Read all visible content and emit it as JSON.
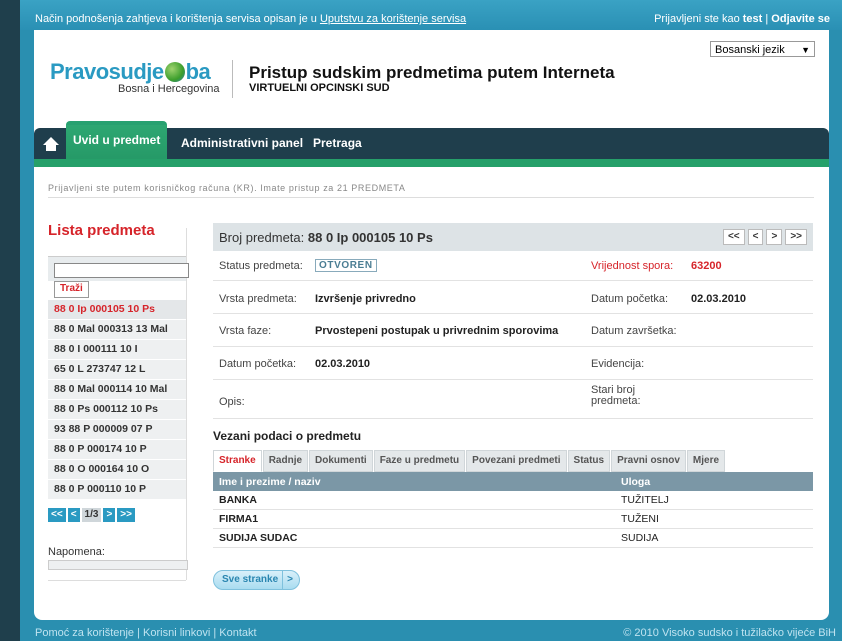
{
  "topbar": {
    "note": "Način podnošenja zahtjeva i korištenja servisa opisan je u ",
    "note_link": "Uputstvu za korištenje servisa",
    "logged_in_as": "Prijavljeni ste kao ",
    "username": "test",
    "separator": " | ",
    "logout": "Odjavite se"
  },
  "header": {
    "language": "Bosanski jezik",
    "logo_left": "Pravosudje",
    "logo_right": "ba",
    "logo_sub": "Bosna i Hercegovina",
    "site_title": "Pristup sudskim predmetima putem Interneta",
    "site_sub": "VIRTUELNI OPCINSKI SUD"
  },
  "nav": {
    "tabs": [
      {
        "label": "Uvid u predmet"
      },
      {
        "label": "Administrativni panel"
      },
      {
        "label": "Pretraga"
      }
    ]
  },
  "info_line": "Prijavljeni ste putem korisničkog računa (KR). Imate pristup za 21 PREDMETA",
  "left": {
    "title": "Lista predmeta",
    "search_value": "",
    "search_button": "Traži",
    "cases": [
      "88 0 Ip 000105 10 Ps",
      "88 0 Mal 000313 13 Mal",
      "88 0 I 000111 10 I",
      "65 0 L 273747 12 L",
      "88 0 Mal 000114 10 Mal",
      "88 0 Ps 000112 10 Ps",
      "93 88 P 000009 07 P",
      "88 0 P 000174 10 P",
      "88 0 O 000164 10 O",
      "88 0 P 000110 10 P"
    ],
    "pager": {
      "first": "<<",
      "prev": "<",
      "current": "1/3",
      "next": ">",
      "last": ">>"
    },
    "napomena": "Napomena:"
  },
  "case": {
    "header_label": "Broj predmeta: ",
    "number": "88 0 Ip 000105 10 Ps",
    "pager": {
      "first": "<<",
      "prev": "<",
      "next": ">",
      "last": ">>"
    },
    "rows": [
      {
        "l1": "Status predmeta:",
        "v1": "OTVOREN",
        "l2": "Vrijednost spora:",
        "v2": "63200"
      },
      {
        "l1": "Vrsta predmeta:",
        "v1": "Izvršenje privredno",
        "l2": "Datum početka:",
        "v2": "02.03.2010"
      },
      {
        "l1": "Vrsta faze:",
        "v1": "Prvostepeni postupak u privrednim sporovima",
        "l2": "Datum završetka:",
        "v2": ""
      },
      {
        "l1": "Datum početka:",
        "v1": "02.03.2010",
        "l2": "Evidencija:",
        "v2": ""
      },
      {
        "l1": "Opis:",
        "v1": "",
        "l2": "Stari broj predmeta:",
        "v2": ""
      }
    ]
  },
  "related": {
    "title": "Vezani podaci o predmetu",
    "tabs": [
      "Stranke",
      "Radnje",
      "Dokumenti",
      "Faze u predmetu",
      "Povezani predmeti",
      "Status",
      "Pravni osnov",
      "Mjere"
    ],
    "columns": [
      "Ime i prezime / naziv",
      "Uloga"
    ],
    "rows": [
      [
        "BANKA",
        "TUŽITELJ"
      ],
      [
        "FIRMA1",
        "TUŽENI"
      ],
      [
        "SUDIJA SUDAC",
        "SUDIJA"
      ]
    ],
    "all_button": "Sve stranke",
    "all_button_arrow": ">"
  },
  "footer": {
    "links": [
      "Pomoć za korištenje",
      "Korisni linkovi",
      "Kontakt"
    ],
    "sep": " | ",
    "copyright": "© 2010 Visoko sudsko i tužilačko vijeće BiH"
  },
  "colors": {
    "accent": "#2a9ac2",
    "red": "#d6242a",
    "nav": "#1f3e4c",
    "green": "#26a06a"
  }
}
